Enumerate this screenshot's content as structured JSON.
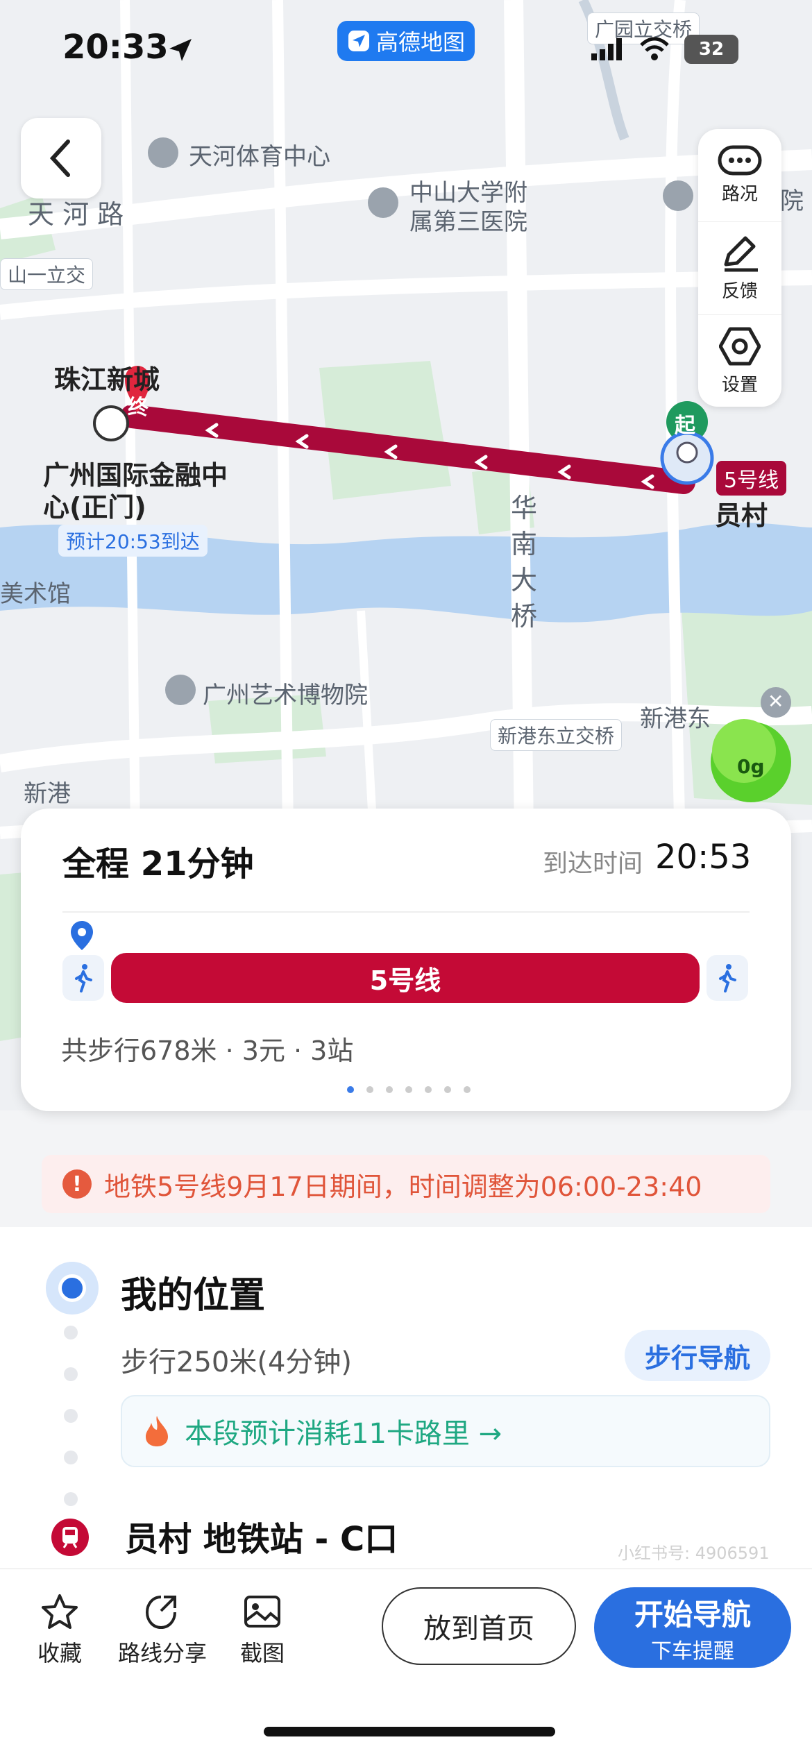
{
  "status_bar": {
    "time": "20:33",
    "app_badge": "高德地图",
    "battery": "32"
  },
  "map": {
    "labels": {
      "tianhe_sports": "天河体育中心",
      "tianhe_road": "天 河 路",
      "zhongshan_hospital_1": "中山大学附",
      "zhongshan_hospital_2": "属第三医院",
      "yuan": "院",
      "zhongshan_interchange": "山一立交",
      "guangyuan_interchange": "广园立交桥",
      "zhujiang_newtown": "珠江新城",
      "ifc_1": "广州国际金融中",
      "ifc_2": "心(正门)",
      "eta_tag": "预计20:53到达",
      "art_museum_left": "美术馆",
      "huanan_bridge": "华\n南\n大\n桥",
      "guangzhou_art_museum": "广州艺术博物院",
      "xingangdong": "新港东",
      "xingangdong_interchange": "新港东立交桥",
      "xingang": "新港",
      "line5_tag": "5号线",
      "yuncun": "员村",
      "start_marker": "起",
      "end_marker": "终",
      "eco_value": "0g"
    }
  },
  "tools": [
    {
      "label": "路况",
      "icon": "traffic-icon"
    },
    {
      "label": "反馈",
      "icon": "feedback-icon"
    },
    {
      "label": "设置",
      "icon": "settings-icon"
    }
  ],
  "route_card": {
    "total": "全程  21分钟",
    "arrive_label": "到达时间",
    "arrive_time": "20:53",
    "line_name": "5号线",
    "summary": "共步行678米 · 3元 · 3站"
  },
  "notice": {
    "text": "地铁5号线9月17日期间，时间调整为06:00-23:40"
  },
  "steps": {
    "my_position": "我的位置",
    "walk_desc": "步行250米(4分钟)",
    "walk_nav": "步行导航",
    "calorie": "本段预计消耗11卡路里 →",
    "station": "员村 地铁站 - C口"
  },
  "bottom_bar": {
    "favorite": "收藏",
    "share": "路线分享",
    "screenshot": "截图",
    "home": "放到首页",
    "start_main": "开始导航",
    "start_sub": "下车提醒"
  },
  "watermark": "小红书号: 4906591"
}
